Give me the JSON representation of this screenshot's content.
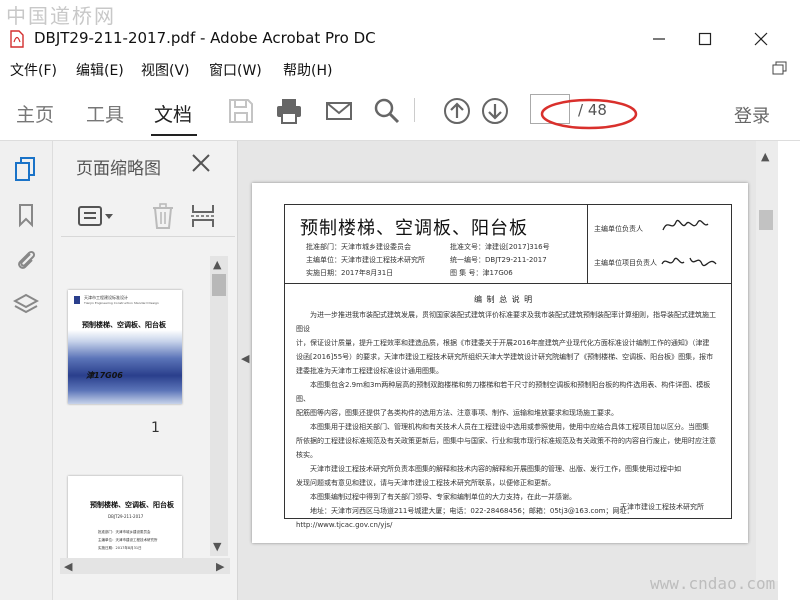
{
  "watermark_top": "中国道桥网",
  "watermark_bottom": "www.cndao.com",
  "window": {
    "title": "DBJT29-211-2017.pdf - Adobe Acrobat Pro DC"
  },
  "menu": [
    "文件(F)",
    "编辑(E)",
    "视图(V)",
    "窗口(W)",
    "帮助(H)"
  ],
  "nav_tabs": [
    {
      "label": "主页",
      "active": false
    },
    {
      "label": "工具",
      "active": false
    },
    {
      "label": "文档",
      "active": true
    }
  ],
  "toolbar": {
    "icons": [
      "save-icon",
      "print-icon",
      "email-icon",
      "search-icon",
      "page-up-icon",
      "page-down-icon"
    ],
    "page_current": "",
    "page_total": "/ 48",
    "login_label": "登录",
    "highlight_color": "#d9302c"
  },
  "left_rail": {
    "icons": [
      "page-thumbnails-icon",
      "bookmark-icon",
      "attachment-icon",
      "layers-icon"
    ],
    "accent": "#1a73c8"
  },
  "thumbnail_panel": {
    "title": "页面缩略图",
    "thumbs": [
      {
        "label": "1",
        "header_lines": [
          "天津市工程建设标准设计",
          "Tianjin Engineering Construction Standard Design"
        ],
        "title": "预制楼梯、空调板、阳台板",
        "code": "津17G06"
      },
      {
        "title": "预制楼梯、空调板、阳台板",
        "code": "DBJT29-211-2017",
        "lines": [
          "批准部门：天津市城乡建设委员会",
          "主编单位：天津市建设工程技术研究所",
          "实施日期：2017年8月31日"
        ]
      }
    ]
  },
  "document": {
    "title": "预制楼梯、空调板、阳台板",
    "meta_left": [
      "批准部门：天津市城乡建设委员会",
      "主编单位：天津市建设工程技术研究所",
      "实施日期：2017年8月31日"
    ],
    "meta_mid": [
      "批准文号：津建设[2017]316号",
      "统一编号：DBJT29-211-2017",
      "图  集  号：津17G06"
    ],
    "sign_labels": [
      "主编单位负责人",
      "主编单位项目负责人"
    ],
    "section_title": "编 制 总 说 明",
    "paragraphs": [
      "为进一步推进我市装配式建筑发展，贯彻国家装配式建筑评价标准要求及我市装配式建筑预制装配率计算细则，指导装配式建筑施工图设",
      "计，保证设计质量，提升工程效率和建造品质，根据《市建委关于开展2016年度建筑产业现代化方面标准设计编制工作的通知》（津建",
      "设函[2016]55号）的要求，天津市建设工程技术研究所组织天津大学建筑设计研究院编制了《预制楼梯、空调板、阳台板》图集，报市",
      "建委批准为天津市工程建设标准设计通用图集。",
      "本图集包含2.9m和3m两种层高的预制双跑楼梯和剪刀楼梯和若干尺寸的预制空调板和预制阳台板的构件选用表、构件详图、模板图、",
      "配筋图等内容，图集还提供了各类构件的选用方法、注意事项、制作、运输和堆放要求和现场施工要求。",
      "本图集用于建设相关部门、管理机构和有关技术人员在工程建设中选用或参照使用，使用中应结合具体工程项目加以区分。当图集",
      "所依据的工程建设标准规范及有关政策更新后，图集中与国家、行业和我市现行标准规范及有关政策不符的内容自行废止，使用时应注意",
      "核实。",
      "天津市建设工程技术研究所负责本图集的解释和技术内容的解释和开展图集的管理、出版、发行工作，图集使用过程中如",
      "发现问题或有意见和建议，请与天津市建设工程技术研究所联系，以便修正和更新。",
      "本图集编制过程中得到了有关部门领导、专家和编制单位的大力支持，在此一并感谢。",
      "地址：天津市河西区马场道211号城建大厦；电话：022-28468456；邮箱：05tj3@163.com；网址：http://www.tjcac.gov.cn/yjs/"
    ],
    "footer_org": "天津市建设工程技术研究所"
  }
}
